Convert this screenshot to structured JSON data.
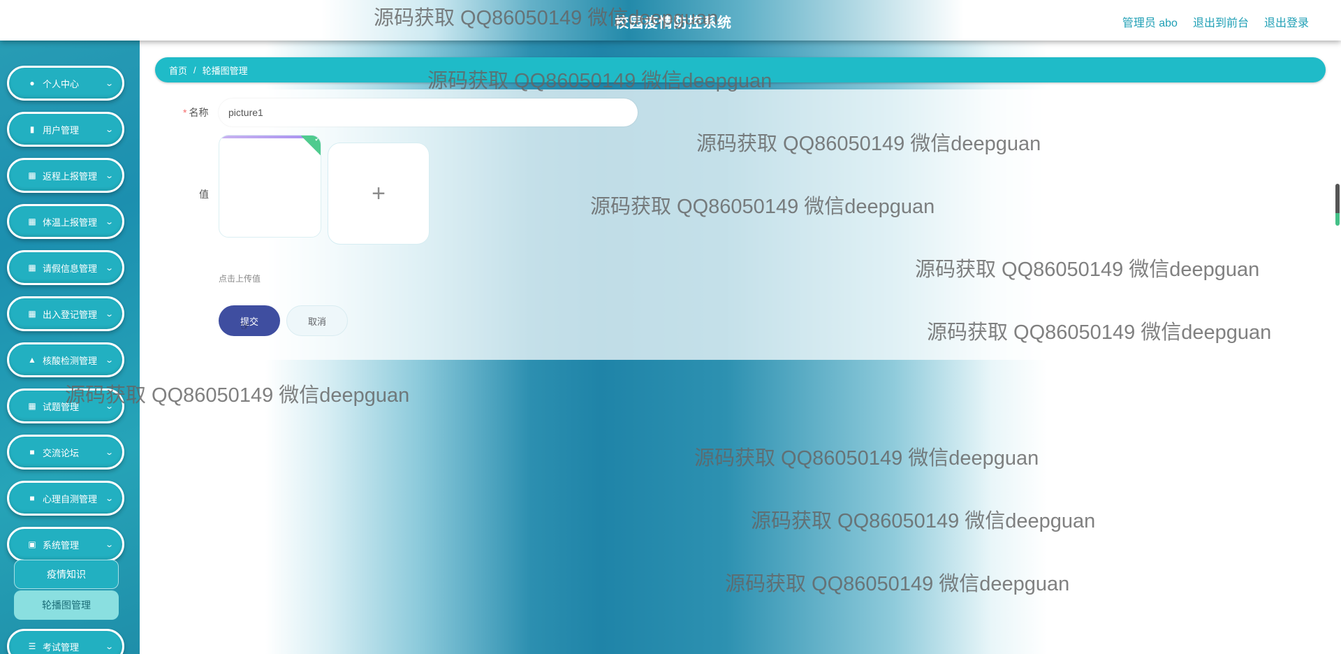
{
  "header": {
    "title": "校园疫情防控系统",
    "links": [
      "管理员 abo",
      "退出到前台",
      "退出登录"
    ]
  },
  "sidebar": {
    "items": [
      {
        "label": "个人中心",
        "icon": "person-icon"
      },
      {
        "label": "用户管理",
        "icon": "clipboard-icon"
      },
      {
        "label": "返程上报管理",
        "icon": "grid-icon"
      },
      {
        "label": "体温上报管理",
        "icon": "grid-icon"
      },
      {
        "label": "请假信息管理",
        "icon": "grid-icon"
      },
      {
        "label": "出入登记管理",
        "icon": "grid-icon"
      },
      {
        "label": "核酸检测管理",
        "icon": "pin-icon"
      },
      {
        "label": "试题管理",
        "icon": "grid-icon"
      },
      {
        "label": "交流论坛",
        "icon": "chat-icon"
      },
      {
        "label": "心理自测管理",
        "icon": "chat-icon"
      },
      {
        "label": "系统管理",
        "icon": "briefcase-icon"
      },
      {
        "label": "考试管理",
        "icon": "list-icon"
      }
    ],
    "submenu": [
      {
        "label": "疫情知识",
        "active": false
      },
      {
        "label": "轮播图管理",
        "active": true
      }
    ]
  },
  "breadcrumb": {
    "home": "首页",
    "separator": "/",
    "current": "轮播图管理"
  },
  "form": {
    "name_label": "名称",
    "required_mark": "*",
    "name_value": "picture1",
    "value_label": "值",
    "upload_symbol": "+",
    "upload_hint": "点击上传值",
    "submit_label": "提交",
    "cancel_label": "取消"
  },
  "watermark_text": "源码获取 QQ86050149 微信deepguan",
  "colors": {
    "accent": "#1fbbc8",
    "submit": "#3f4ea0",
    "required": "#f56c6c",
    "sidebar": "#22b0c1",
    "upload_success": "#4fcb8e"
  }
}
